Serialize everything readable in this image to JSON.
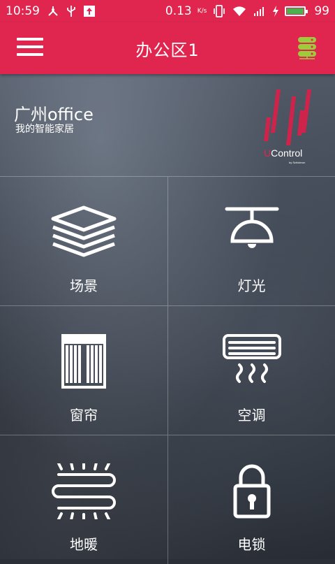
{
  "status_bar": {
    "time": "10:59",
    "net_speed": "0.13",
    "net_unit": "K/s",
    "battery": "99"
  },
  "app_bar": {
    "title": "办公区1",
    "menu_icon": "hamburger-menu-icon",
    "right_icon": "server-icon"
  },
  "location": {
    "name": "广州office",
    "subtitle": "我的智能家居"
  },
  "brand": {
    "name": "UControl",
    "tagline": "by Schiderun"
  },
  "colors": {
    "accent": "#e0264f",
    "battery": "#4caf50",
    "server_icon": "#9ccc3c"
  },
  "tiles": [
    {
      "label": "场景",
      "icon": "scene-layers-icon"
    },
    {
      "label": "灯光",
      "icon": "pendant-lamp-icon"
    },
    {
      "label": "窗帘",
      "icon": "curtain-icon"
    },
    {
      "label": "空调",
      "icon": "air-conditioner-icon"
    },
    {
      "label": "地暖",
      "icon": "floor-heating-icon"
    },
    {
      "label": "电锁",
      "icon": "padlock-icon"
    }
  ]
}
